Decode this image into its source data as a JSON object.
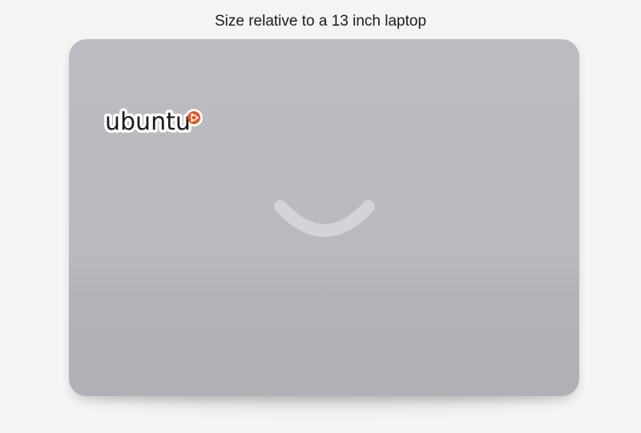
{
  "caption": "Size relative to a 13 inch laptop",
  "sticker": {
    "text": "ubuntu",
    "icon": "ubuntu-circle-of-friends-icon",
    "text_color": "#1a1a1a",
    "accent_color": "#e95420"
  },
  "laptop": {
    "lid_color": "#b9babf",
    "logo_icon": "smile-logo-icon",
    "logo_color": "#d2d4d8"
  }
}
